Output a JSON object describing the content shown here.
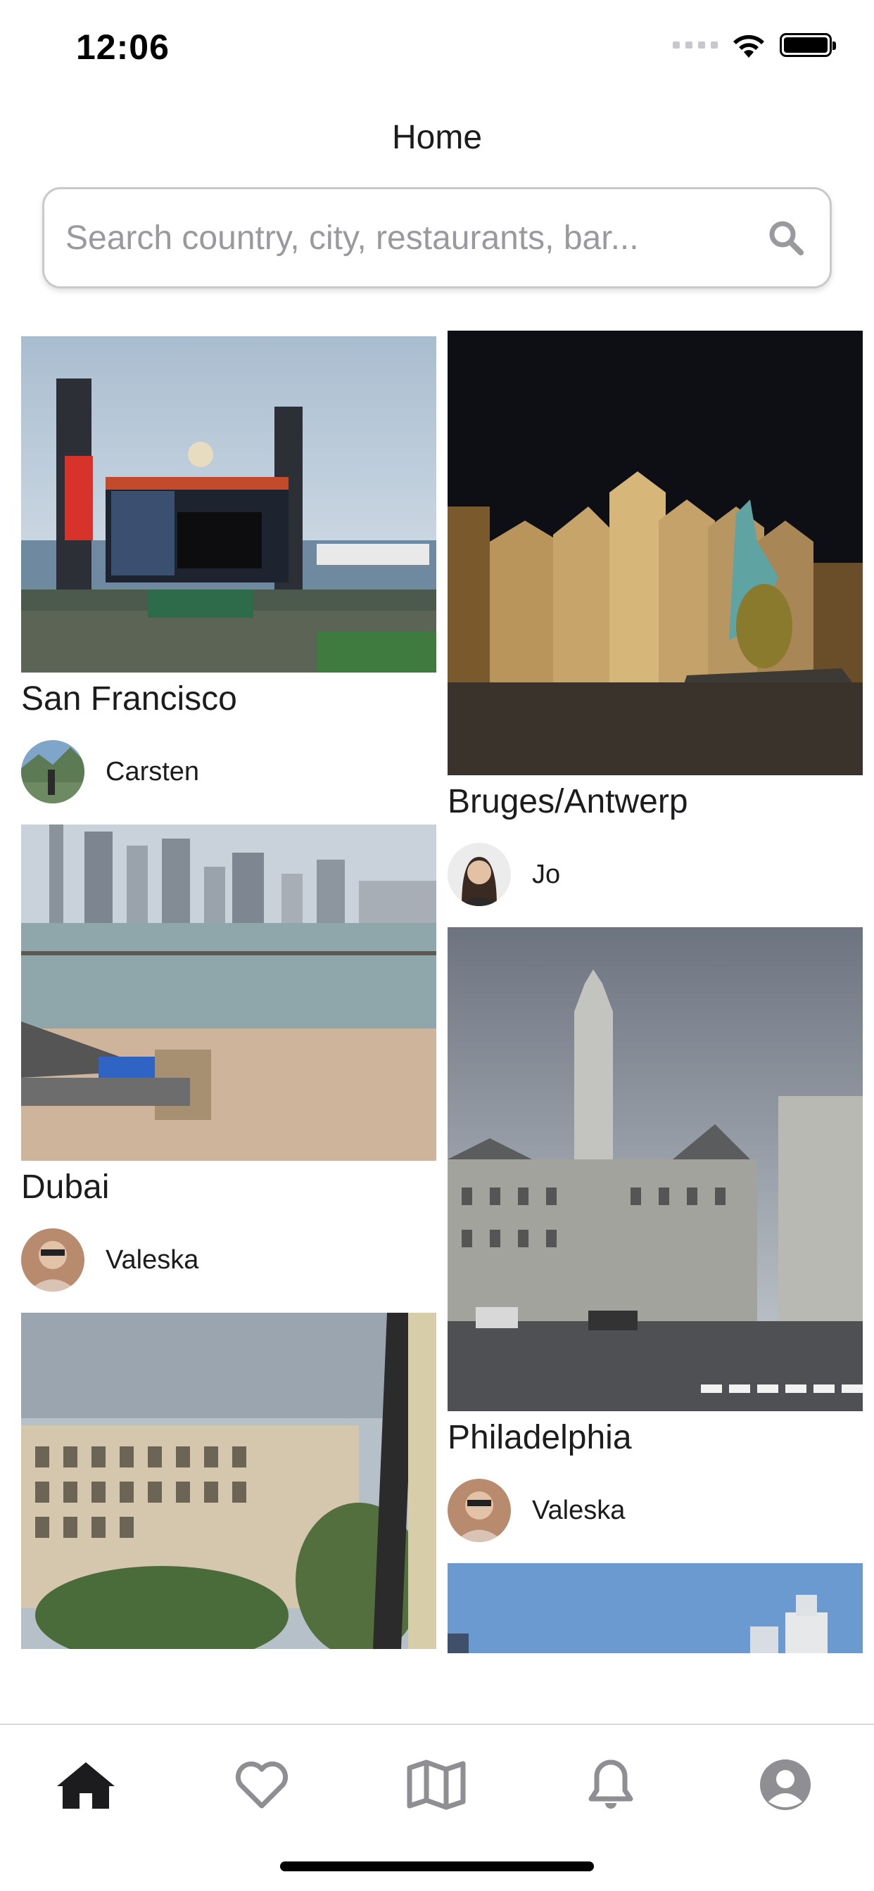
{
  "status_bar": {
    "time": "12:06"
  },
  "header": {
    "title": "Home"
  },
  "search": {
    "placeholder": "Search country, city, restaurants, bar..."
  },
  "posts": [
    {
      "title": "San Francisco",
      "author": "Carsten"
    },
    {
      "title": "Bruges/Antwerp",
      "author": "Jo"
    },
    {
      "title": "Dubai",
      "author": "Valeska"
    },
    {
      "title": "Philadelphia",
      "author": "Valeska"
    }
  ],
  "tabs": [
    {
      "icon": "home-icon",
      "active": true
    },
    {
      "icon": "heart-icon",
      "active": false
    },
    {
      "icon": "map-icon",
      "active": false
    },
    {
      "icon": "bell-icon",
      "active": false
    },
    {
      "icon": "profile-icon",
      "active": false
    }
  ],
  "colors": {
    "active_tab": "#1c1c1e",
    "inactive_tab": "#8e8e93",
    "text": "#1c1c1e"
  }
}
